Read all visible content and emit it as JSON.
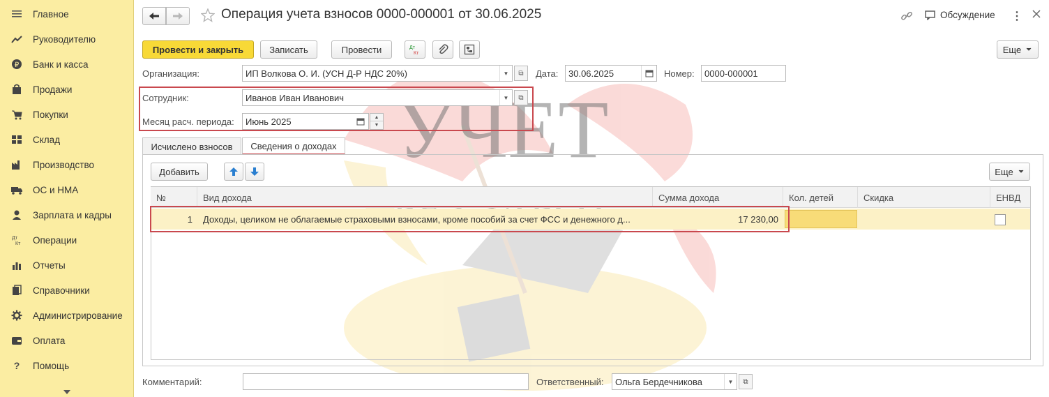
{
  "sidebar": {
    "items": [
      {
        "label": "Главное",
        "icon": "menu-icon"
      },
      {
        "label": "Руководителю",
        "icon": "trend-icon"
      },
      {
        "label": "Банк и касса",
        "icon": "coin-icon"
      },
      {
        "label": "Продажи",
        "icon": "bag-icon"
      },
      {
        "label": "Покупки",
        "icon": "cart-icon"
      },
      {
        "label": "Склад",
        "icon": "warehouse-icon"
      },
      {
        "label": "Производство",
        "icon": "factory-icon"
      },
      {
        "label": "ОС и НМА",
        "icon": "truck-icon"
      },
      {
        "label": "Зарплата и кадры",
        "icon": "person-icon"
      },
      {
        "label": "Операции",
        "icon": "dt-kt-icon"
      },
      {
        "label": "Отчеты",
        "icon": "bar-chart-icon"
      },
      {
        "label": "Справочники",
        "icon": "books-icon"
      },
      {
        "label": "Администрирование",
        "icon": "gear-icon"
      },
      {
        "label": "Оплата",
        "icon": "wallet-icon"
      },
      {
        "label": "Помощь",
        "icon": "question-icon"
      }
    ]
  },
  "header": {
    "title": "Операция учета взносов 0000-000001 от 30.06.2025",
    "discussion_label": "Обсуждение"
  },
  "toolbar": {
    "post_close_label": "Провести и закрыть",
    "save_label": "Записать",
    "post_label": "Провести",
    "dtkt_label": "Дт Кт",
    "more_label": "Еще"
  },
  "form": {
    "organization_label": "Организация:",
    "organization_value": "ИП Волкова О. И. (УСН Д-Р НДС 20%)",
    "date_label": "Дата:",
    "date_value": "30.06.2025",
    "number_label": "Номер:",
    "number_value": "0000-000001",
    "employee_label": "Сотрудник:",
    "employee_value": "Иванов Иван Иванович",
    "month_label": "Месяц расч. периода:",
    "month_value": "Июнь 2025"
  },
  "tabs": [
    {
      "label": "Исчислено взносов"
    },
    {
      "label": "Сведения о доходах"
    }
  ],
  "table_toolbar": {
    "add_label": "Добавить",
    "more_label": "Еще"
  },
  "table": {
    "columns": [
      "№",
      "Вид дохода",
      "Сумма дохода",
      "Кол. детей",
      "Скидка",
      "ЕНВД"
    ],
    "rows": [
      {
        "num": "1",
        "income_type": "Доходы, целиком не облагаемые страховыми взносами, кроме пособий за счет ФСС и денежного д...",
        "amount": "17 230,00",
        "children": "",
        "discount": "",
        "envd": false
      }
    ]
  },
  "footer": {
    "comment_label": "Комментарий:",
    "comment_value": "",
    "responsible_label": "Ответственный:",
    "responsible_value": "Ольга Бердечникова"
  },
  "watermark": {
    "line1": "УЧЕТ",
    "line2": "БЕЗ ЗАБОТ"
  },
  "colors": {
    "sidebar_bg": "#fbeda2",
    "primary_button": "#f8d937",
    "highlight_box": "#c9484e",
    "selected_row": "#fcf1c6",
    "arrow_blue": "#2a7fd0"
  }
}
